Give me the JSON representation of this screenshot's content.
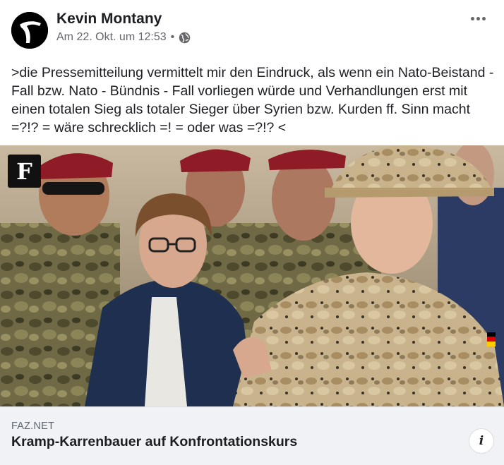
{
  "post": {
    "author": "Kevin Montany",
    "timestamp": "Am 22. Okt. um 12:53",
    "separator": "•",
    "audience_icon": "globe-icon",
    "more_icon": "more-options-icon",
    "text": ">die Pressemitteilung vermittelt mir den Eindruck, als wenn ein Nato-Beistand - Fall bzw. Nato - Bündnis - Fall vorliegen würde und Verhandlungen erst mit einen totalen Sieg als totaler Sieger über Syrien bzw. Kurden ff. Sinn macht =?!? = wäre schrecklich =! = oder was =?!? <"
  },
  "link_preview": {
    "domain": "FAZ.NET",
    "title": "Kramp-Karrenbauer auf Konfrontationskurs",
    "info_label": "i",
    "badge_letter": "F"
  },
  "colors": {
    "secondary_text": "#65676b",
    "footer_bg": "#f0f2f5",
    "beret_red": "#8e1b25",
    "jacket_navy": "#1f2f4f"
  }
}
